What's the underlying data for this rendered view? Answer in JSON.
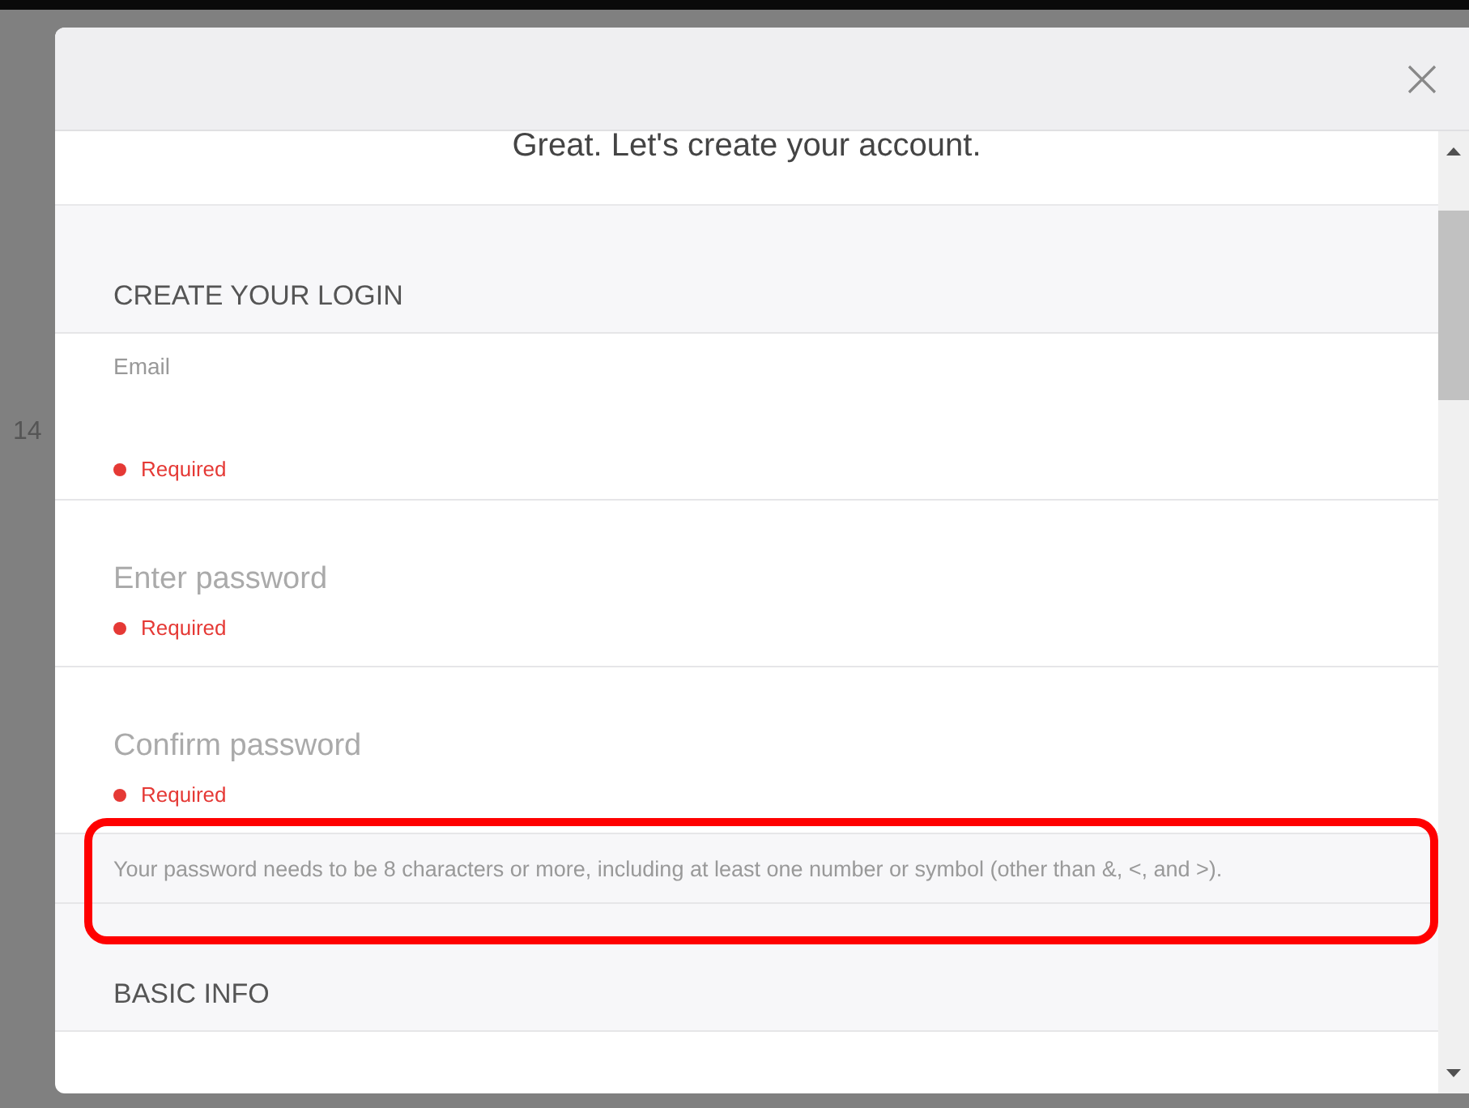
{
  "background": {
    "side_number": "14"
  },
  "dialog": {
    "title": "Great. Let's create your account.",
    "sections": [
      {
        "heading": "CREATE YOUR LOGIN",
        "fields": [
          {
            "kind": "label",
            "label": "Email",
            "error": "Required"
          },
          {
            "kind": "placeholder",
            "placeholder": "Enter password",
            "error": "Required"
          },
          {
            "kind": "placeholder",
            "placeholder": "Confirm password",
            "error": "Required"
          }
        ],
        "hint": "Your password needs to be 8 characters or more, including at least one number or symbol (other than &, <, and >).",
        "highlighted": true
      },
      {
        "heading": "BASIC INFO"
      }
    ]
  }
}
